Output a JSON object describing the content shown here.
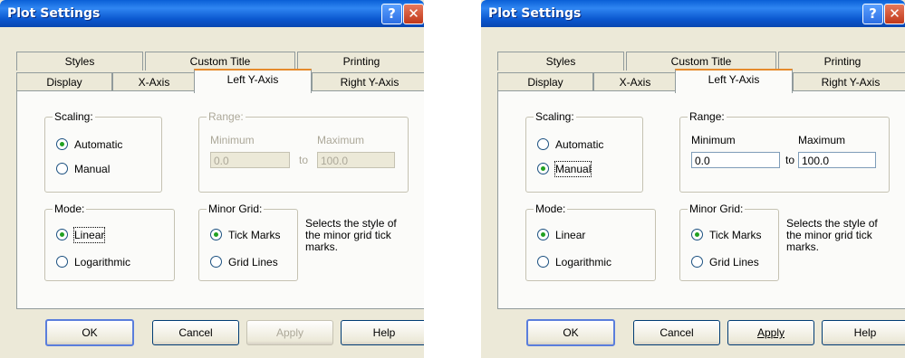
{
  "dialogs": [
    {
      "title": "Plot Settings",
      "title_buttons": {
        "help": "?",
        "close": "✕"
      },
      "tabs_row1": [
        "Styles",
        "Custom Title",
        "Printing"
      ],
      "tabs_row2": [
        "Display",
        "X-Axis",
        "Left Y-Axis",
        "Right Y-Axis"
      ],
      "active_tab": "Left Y-Axis",
      "scaling": {
        "label": "Scaling:",
        "options": [
          "Automatic",
          "Manual"
        ],
        "selected": "Automatic"
      },
      "range": {
        "label": "Range:",
        "min_label": "Minimum",
        "max_label": "Maximum",
        "min_value": "0.0",
        "max_value": "100.0",
        "to": "to",
        "enabled": false
      },
      "mode": {
        "label": "Mode:",
        "options": [
          "Linear",
          "Logarithmic"
        ],
        "selected": "Linear"
      },
      "minor_grid": {
        "label": "Minor Grid:",
        "options": [
          "Tick Marks",
          "Grid Lines"
        ],
        "selected": "Tick Marks"
      },
      "note": "Selects the style of the minor grid tick marks.",
      "buttons": {
        "ok": "OK",
        "cancel": "Cancel",
        "apply": "Apply",
        "help": "Help"
      },
      "apply_enabled": false
    },
    {
      "title": "Plot Settings",
      "title_buttons": {
        "help": "?",
        "close": "✕"
      },
      "tabs_row1": [
        "Styles",
        "Custom Title",
        "Printing"
      ],
      "tabs_row2": [
        "Display",
        "X-Axis",
        "Left Y-Axis",
        "Right Y-Axis"
      ],
      "active_tab": "Left Y-Axis",
      "scaling": {
        "label": "Scaling:",
        "options": [
          "Automatic",
          "Manual"
        ],
        "selected": "Manual"
      },
      "range": {
        "label": "Range:",
        "min_label": "Minimum",
        "max_label": "Maximum",
        "min_value": "0.0",
        "max_value": "100.0",
        "to": "to",
        "enabled": true
      },
      "mode": {
        "label": "Mode:",
        "options": [
          "Linear",
          "Logarithmic"
        ],
        "selected": "Linear"
      },
      "minor_grid": {
        "label": "Minor Grid:",
        "options": [
          "Tick Marks",
          "Grid Lines"
        ],
        "selected": "Tick Marks"
      },
      "note": "Selects the style of the minor grid tick marks.",
      "buttons": {
        "ok": "OK",
        "cancel": "Cancel",
        "apply": "Apply",
        "help": "Help"
      },
      "apply_enabled": true
    }
  ]
}
